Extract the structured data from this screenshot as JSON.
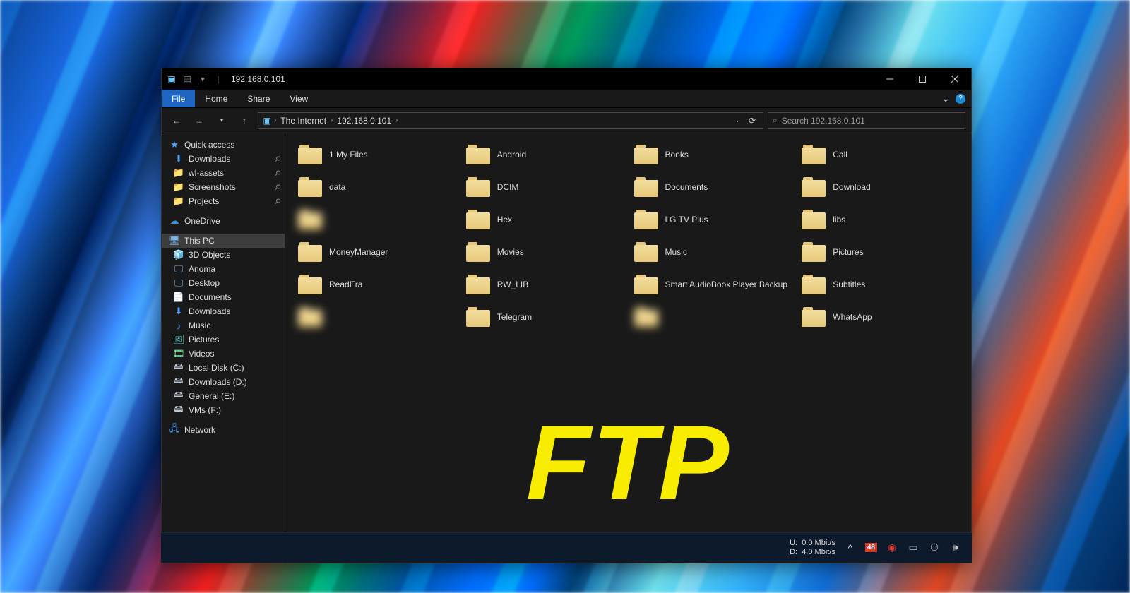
{
  "title": "192.168.0.101",
  "ribbon": {
    "file": "File",
    "home": "Home",
    "share": "Share",
    "view": "View"
  },
  "breadcrumb": {
    "root": "The Internet",
    "ip": "192.168.0.101"
  },
  "search": {
    "placeholder": "Search 192.168.0.101"
  },
  "nav": {
    "quick_access": "Quick access",
    "qa": [
      {
        "label": "Downloads",
        "icon": "download",
        "pin": true
      },
      {
        "label": "wl-assets",
        "icon": "folder",
        "pin": true
      },
      {
        "label": "Screenshots",
        "icon": "folder",
        "pin": true
      },
      {
        "label": "Projects",
        "icon": "folder",
        "pin": true
      }
    ],
    "onedrive": "OneDrive",
    "this_pc": "This PC",
    "pc": [
      {
        "label": "3D Objects",
        "icon": "3d"
      },
      {
        "label": "Anoma",
        "icon": "monitor"
      },
      {
        "label": "Desktop",
        "icon": "desktop"
      },
      {
        "label": "Documents",
        "icon": "doc"
      },
      {
        "label": "Downloads",
        "icon": "download"
      },
      {
        "label": "Music",
        "icon": "music"
      },
      {
        "label": "Pictures",
        "icon": "pictures"
      },
      {
        "label": "Videos",
        "icon": "video"
      },
      {
        "label": "Local Disk (C:)",
        "icon": "disk"
      },
      {
        "label": "Downloads (D:)",
        "icon": "disk"
      },
      {
        "label": "General (E:)",
        "icon": "disk"
      },
      {
        "label": "VMs (F:)",
        "icon": "disk"
      }
    ],
    "network": "Network"
  },
  "folders": [
    {
      "label": "1 My Files"
    },
    {
      "label": "Android"
    },
    {
      "label": "Books"
    },
    {
      "label": "Call"
    },
    {
      "label": "data"
    },
    {
      "label": "DCIM"
    },
    {
      "label": "Documents"
    },
    {
      "label": "Download"
    },
    {
      "label": "blurred",
      "blur": true
    },
    {
      "label": "Hex"
    },
    {
      "label": "LG TV Plus"
    },
    {
      "label": "libs"
    },
    {
      "label": "MoneyManager"
    },
    {
      "label": "Movies"
    },
    {
      "label": "Music"
    },
    {
      "label": "Pictures"
    },
    {
      "label": "ReadEra"
    },
    {
      "label": "RW_LIB"
    },
    {
      "label": "Smart AudioBook Player Backup"
    },
    {
      "label": "Subtitles"
    },
    {
      "label": "blurred",
      "blur": true
    },
    {
      "label": "Telegram"
    },
    {
      "label": "blurred",
      "blur": true
    },
    {
      "label": "WhatsApp"
    }
  ],
  "overlay": "FTP",
  "taskbar": {
    "speed_u_label": "U:",
    "speed_u": "0.0 Mbit/s",
    "speed_d_label": "D:",
    "speed_d": "4.0 Mbit/s",
    "badge": "48"
  }
}
